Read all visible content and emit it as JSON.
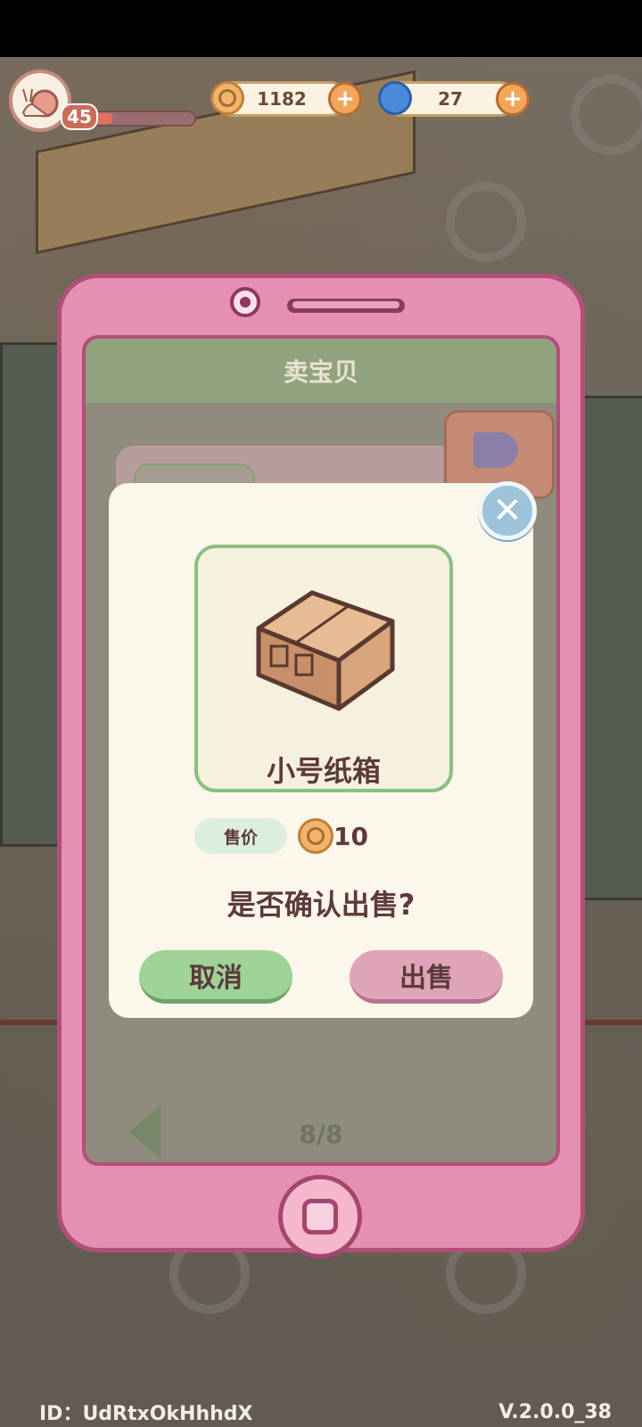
{
  "hud": {
    "level": "45",
    "coins": "1182",
    "gems": "27",
    "plus_symbol": "+"
  },
  "phone": {
    "title": "卖宝贝",
    "page_indicator": "8/8"
  },
  "dialog": {
    "item_name": "小号纸箱",
    "price_label": "售价",
    "price_value": "10",
    "confirm_question": "是否确认出售?",
    "cancel_label": "取消",
    "sell_label": "出售",
    "close_symbol": "✕"
  },
  "footer": {
    "player_id": "ID：UdRtxOkHhhdX",
    "version": "V.2.0.0_38"
  },
  "colors": {
    "phone_pink": "#e590b0",
    "header_green": "#91a27f",
    "cancel_green": "#9fd297",
    "sell_pink": "#e0a4b8",
    "text_brown": "#5c3a3c"
  }
}
